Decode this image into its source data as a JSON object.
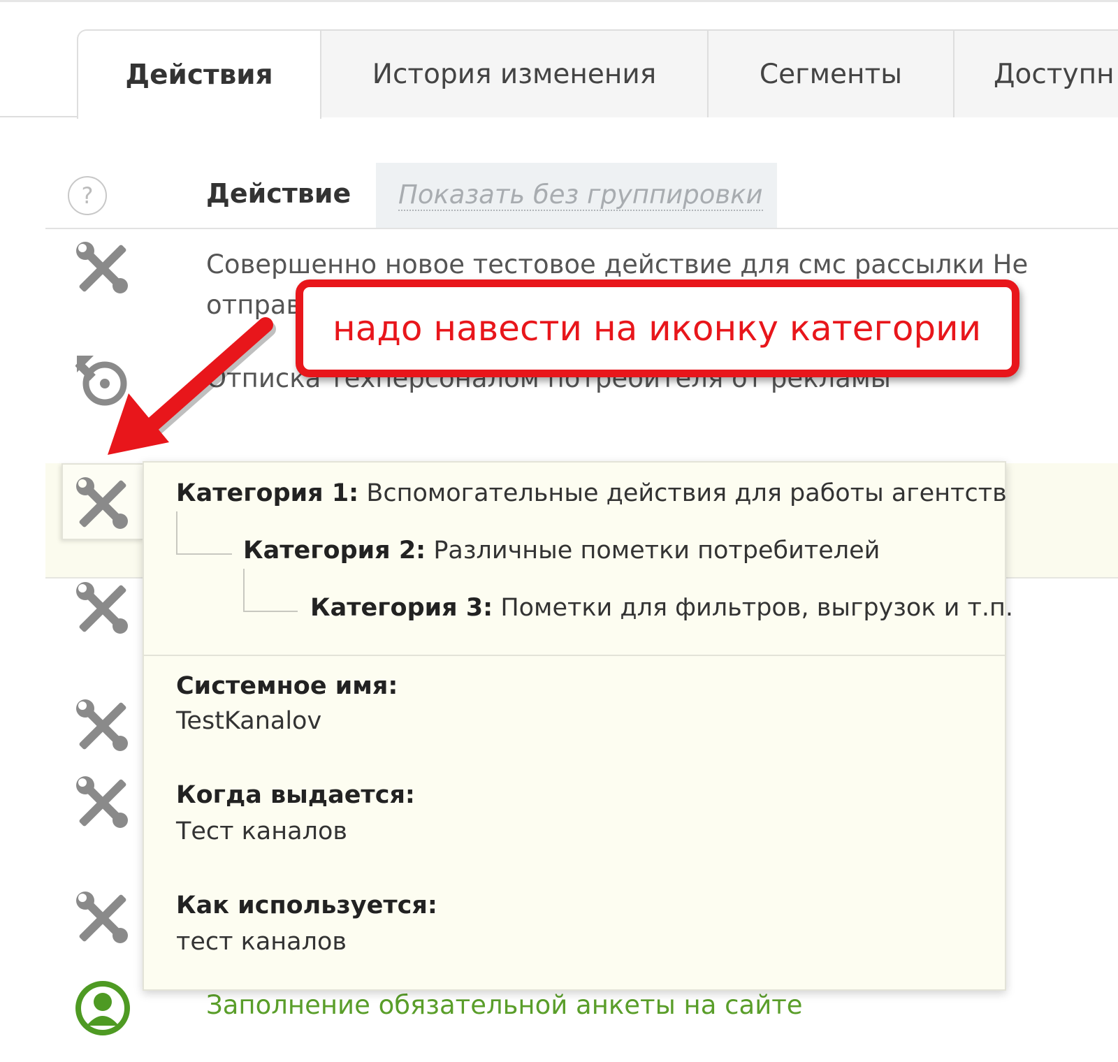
{
  "tabs": [
    {
      "label": "Действия",
      "active": true
    },
    {
      "label": "История изменения",
      "active": false
    },
    {
      "label": "Сегменты",
      "active": false
    },
    {
      "label": "Доступн",
      "active": false
    }
  ],
  "header": {
    "help_symbol": "?",
    "column_title": "Действие",
    "group_toggle": "Показать без группировки"
  },
  "rows": [
    {
      "icon": "tools-icon",
      "text_line1": "Совершенно новое тестовое действие для смс рассылки Не",
      "text_line2": "отправ"
    },
    {
      "icon": "unsubscribe-icon",
      "text": "Отписка техперсоналом потребителя от рекламы"
    },
    {
      "icon": "tools-icon",
      "text": ""
    },
    {
      "icon": "tools-icon",
      "text": ""
    },
    {
      "icon": "tools-icon",
      "text": ""
    },
    {
      "icon": "tools-icon",
      "text": ""
    },
    {
      "icon": "tools-icon",
      "text": ""
    },
    {
      "icon": "user-icon",
      "text": "Заполнение обязательной анкеты на сайте"
    }
  ],
  "tooltip": {
    "categories": [
      {
        "label": "Категория 1:",
        "value": "Вспомогательные действия для работы агентств"
      },
      {
        "label": "Категория 2:",
        "value": "Различные пометки потребителей"
      },
      {
        "label": "Категория 3:",
        "value": "Пометки для фильтров, выгрузок и т.п."
      }
    ],
    "system_name_label": "Системное имя:",
    "system_name_value": "TestKanalov",
    "when_label": "Когда выдается:",
    "when_value": "Тест каналов",
    "how_label": "Как используется:",
    "how_value": "тест каналов"
  },
  "callout": {
    "text": "надо навести на иконку категории",
    "color": "#e8161b"
  },
  "colors": {
    "link_green": "#5a9e2a",
    "icon_gray": "#8a8a8a",
    "tooltip_bg": "#fdfdf1"
  }
}
